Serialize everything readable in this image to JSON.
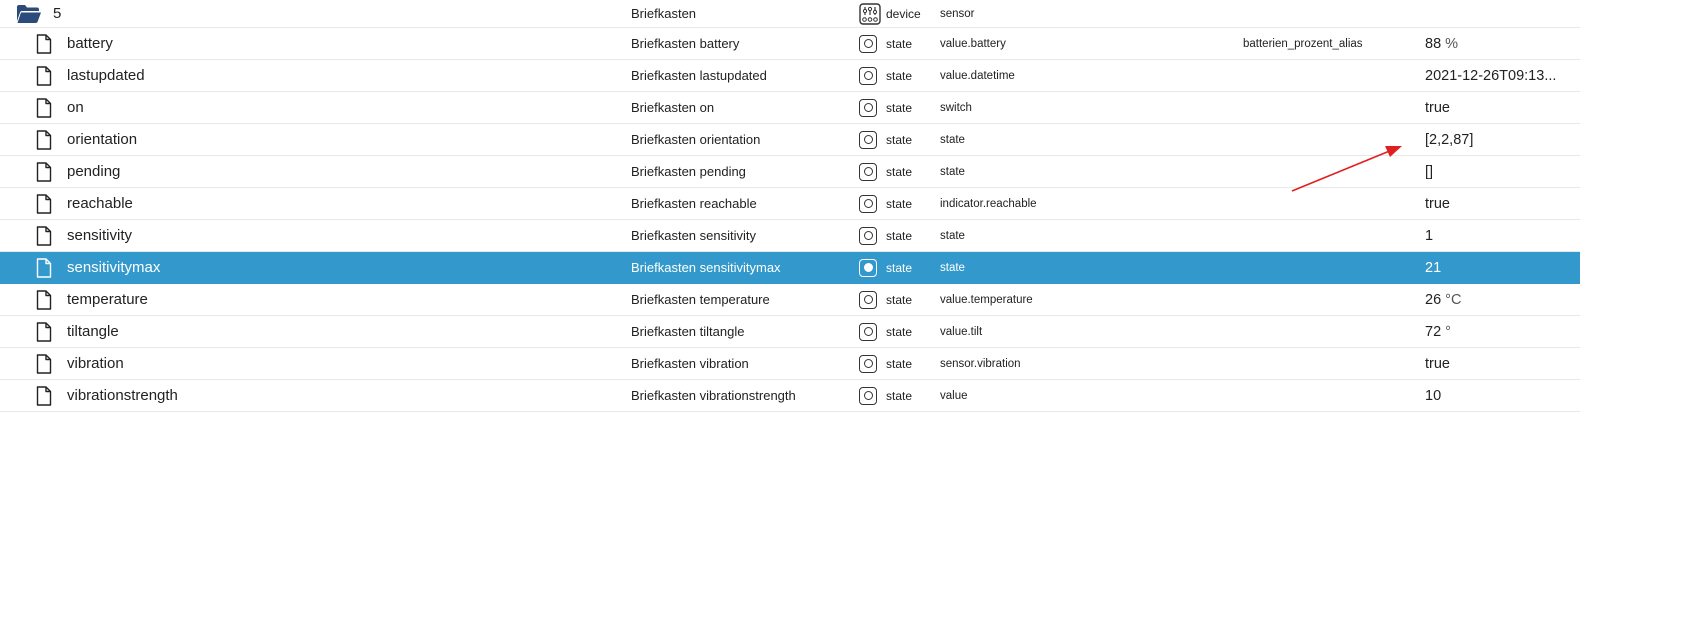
{
  "folder": {
    "id": "5",
    "name": "Briefkasten",
    "type": "device",
    "role": "sensor",
    "icon": "folder-open-icon",
    "type_icon": "device-icon"
  },
  "rows": [
    {
      "id": "battery",
      "name": "Briefkasten battery",
      "type": "state",
      "role": "value.battery",
      "alias": "batterien_prozent_alias",
      "value": "88",
      "unit": "%"
    },
    {
      "id": "lastupdated",
      "name": "Briefkasten lastupdated",
      "type": "state",
      "role": "value.datetime",
      "alias": "",
      "value": "2021-12-26T09:13...",
      "unit": ""
    },
    {
      "id": "on",
      "name": "Briefkasten on",
      "type": "state",
      "role": "switch",
      "alias": "",
      "value": "true",
      "unit": ""
    },
    {
      "id": "orientation",
      "name": "Briefkasten orientation",
      "type": "state",
      "role": "state",
      "alias": "",
      "value": "[2,2,87]",
      "unit": ""
    },
    {
      "id": "pending",
      "name": "Briefkasten pending",
      "type": "state",
      "role": "state",
      "alias": "",
      "value": "[]",
      "unit": ""
    },
    {
      "id": "reachable",
      "name": "Briefkasten reachable",
      "type": "state",
      "role": "indicator.reachable",
      "alias": "",
      "value": "true",
      "unit": ""
    },
    {
      "id": "sensitivity",
      "name": "Briefkasten sensitivity",
      "type": "state",
      "role": "state",
      "alias": "",
      "value": "1",
      "unit": ""
    },
    {
      "id": "sensitivitymax",
      "name": "Briefkasten sensitivitymax",
      "type": "state",
      "role": "state",
      "alias": "",
      "value": "21",
      "unit": "",
      "selected": true
    },
    {
      "id": "temperature",
      "name": "Briefkasten temperature",
      "type": "state",
      "role": "value.temperature",
      "alias": "",
      "value": "26",
      "unit": "°C"
    },
    {
      "id": "tiltangle",
      "name": "Briefkasten tiltangle",
      "type": "state",
      "role": "value.tilt",
      "alias": "",
      "value": "72",
      "unit": "°"
    },
    {
      "id": "vibration",
      "name": "Briefkasten vibration",
      "type": "state",
      "role": "sensor.vibration",
      "alias": "",
      "value": "true",
      "unit": ""
    },
    {
      "id": "vibrationstrength",
      "name": "Briefkasten vibrationstrength",
      "type": "state",
      "role": "value",
      "alias": "",
      "value": "10",
      "unit": ""
    }
  ],
  "colors": {
    "selected_row": "#3399cc",
    "annotation_arrow": "#e02020",
    "folder_icon": "#2c4a7a"
  }
}
